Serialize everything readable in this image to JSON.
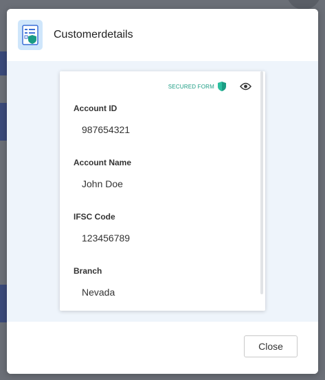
{
  "modal": {
    "title": "Customerdetails",
    "header_icon": "secure-form-icon"
  },
  "form": {
    "secured_label": "SECURED FORM",
    "shield_icon": "shield-icon",
    "eye_icon": "eye-icon",
    "fields": [
      {
        "label": "Account ID",
        "value": "987654321"
      },
      {
        "label": "Account Name",
        "value": "John Doe"
      },
      {
        "label": "IFSC Code",
        "value": "123456789"
      },
      {
        "label": "Branch",
        "value": "Nevada"
      }
    ]
  },
  "footer": {
    "close_label": "Close"
  },
  "colors": {
    "accent_green": "#1a9c83",
    "icon_bg": "#cfe6fb",
    "body_bg": "#eef4fb"
  }
}
